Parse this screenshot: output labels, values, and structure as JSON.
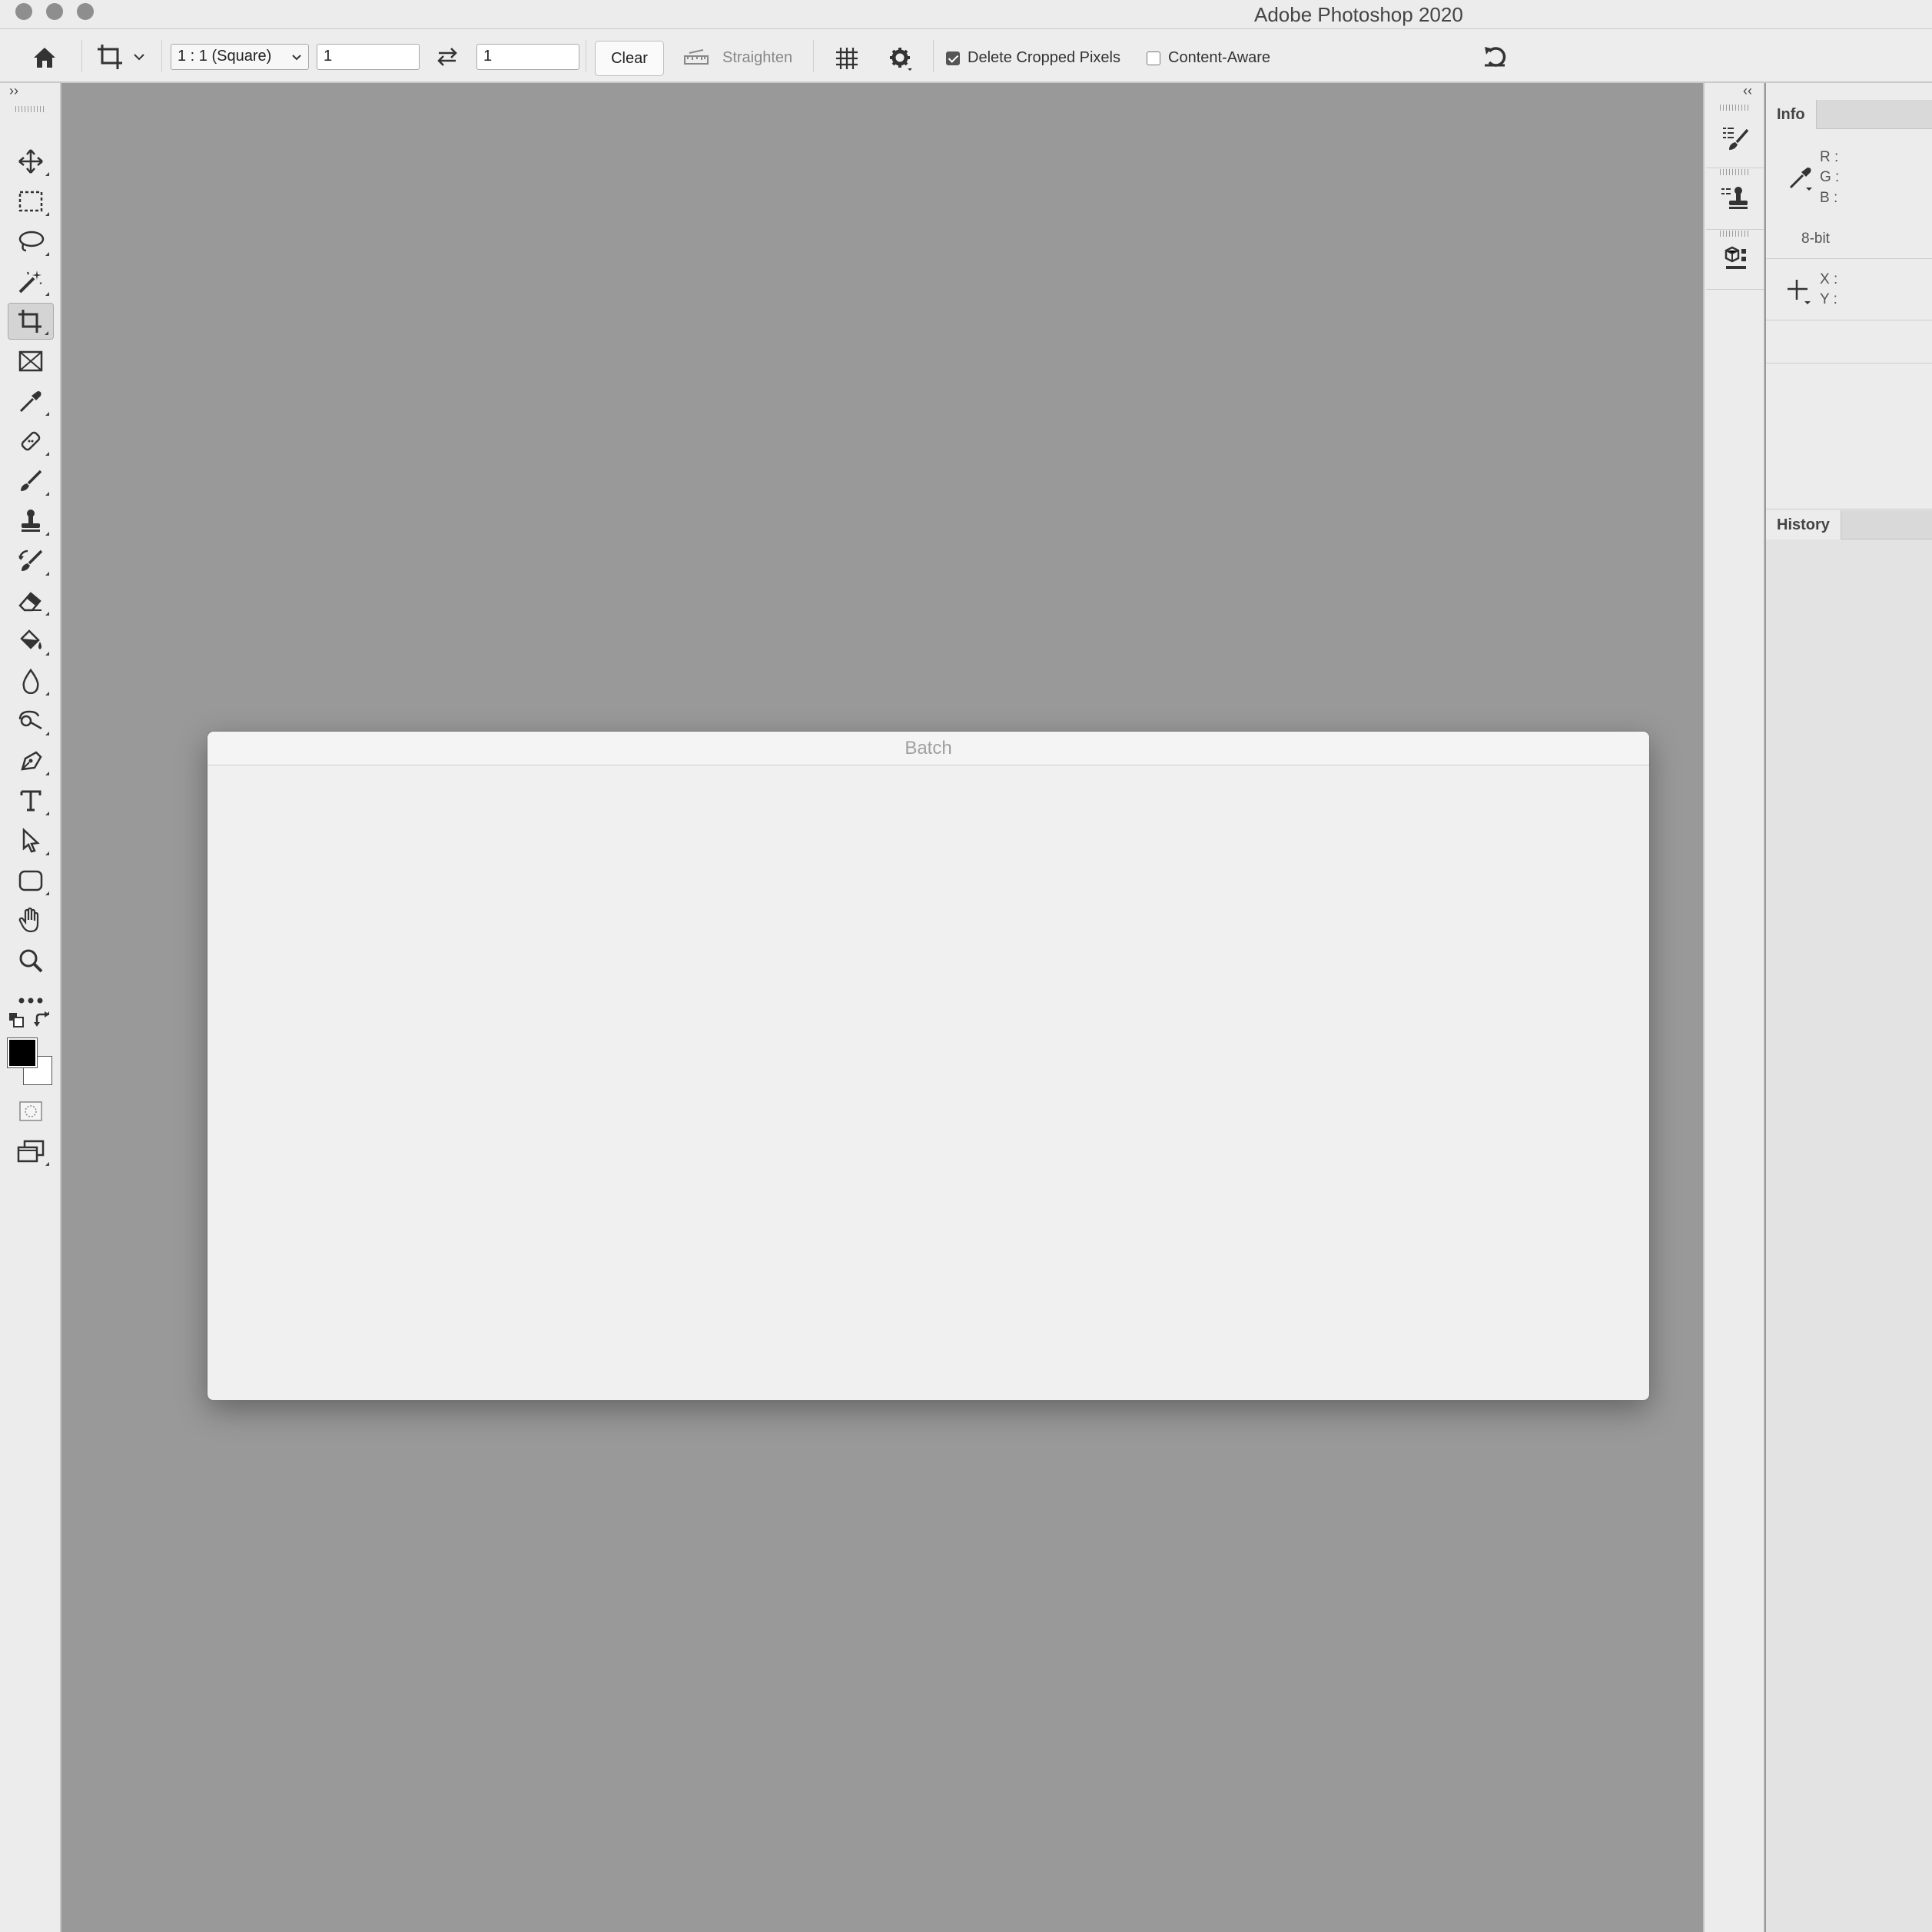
{
  "window": {
    "title": "Adobe Photoshop 2020"
  },
  "options_bar": {
    "ratio_preset": "1 : 1 (Square)",
    "width_value": "1",
    "height_value": "1",
    "clear_label": "Clear",
    "straighten_label": "Straighten",
    "delete_cropped_label": "Delete Cropped Pixels",
    "delete_cropped_checked": true,
    "content_aware_label": "Content-Aware",
    "content_aware_checked": false
  },
  "toolbar": {
    "collapse_glyph": "››",
    "tools": [
      {
        "icon": "move-icon"
      },
      {
        "icon": "marquee-icon"
      },
      {
        "icon": "lasso-icon"
      },
      {
        "icon": "magic-wand-icon"
      },
      {
        "icon": "crop-icon",
        "active": true
      },
      {
        "icon": "frame-icon"
      },
      {
        "icon": "eyedropper-icon"
      },
      {
        "icon": "healing-brush-icon"
      },
      {
        "icon": "brush-icon"
      },
      {
        "icon": "clone-stamp-icon"
      },
      {
        "icon": "history-brush-icon"
      },
      {
        "icon": "eraser-icon"
      },
      {
        "icon": "paint-bucket-icon"
      },
      {
        "icon": "blur-icon"
      },
      {
        "icon": "dodge-icon"
      },
      {
        "icon": "pen-icon"
      },
      {
        "icon": "type-icon"
      },
      {
        "icon": "path-selection-icon"
      },
      {
        "icon": "rectangle-shape-icon"
      },
      {
        "icon": "hand-icon"
      },
      {
        "icon": "zoom-icon"
      },
      {
        "icon": "more-tools-icon"
      }
    ],
    "foreground_color": "#000000",
    "background_color": "#ffffff"
  },
  "dialog": {
    "title": "Batch"
  },
  "dock": {
    "collapse_glyph": "‹‹"
  },
  "info_panel": {
    "tab_label": "Info",
    "r_label": "R :",
    "g_label": "G :",
    "b_label": "B :",
    "bit_depth": "8-bit",
    "x_label": "X :",
    "y_label": "Y :"
  },
  "history_panel": {
    "tab_label": "History"
  }
}
